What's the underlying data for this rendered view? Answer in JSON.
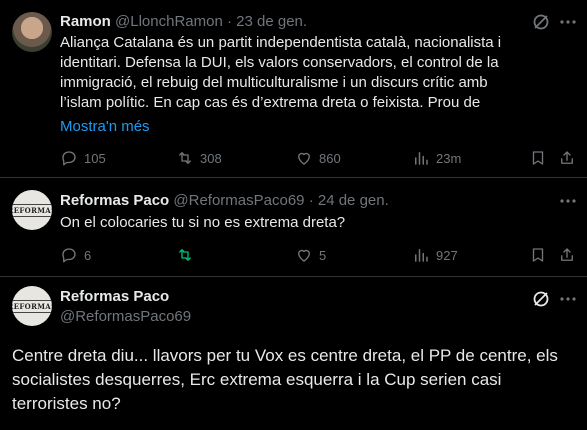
{
  "tweets": [
    {
      "name": "Ramon",
      "handle": "@LlonchRamon",
      "sep": "·",
      "date": "23 de gen.",
      "text": "Aliança Catalana és un partit independentista català, nacionalista i identitari. Defensa la DUI, els valors conservadors, el control de la immigració, el rebuig del multiculturalisme i un discurs crític amb l’islam polític. En cap cas és d’extrema dreta o feixista. Prou de",
      "show_more": "Mostra'n més",
      "replies": "105",
      "retweets": "308",
      "likes": "860",
      "views": "23m"
    },
    {
      "name": "Reformas Paco",
      "handle": "@ReformasPaco69",
      "sep": "·",
      "date": "24 de gen.",
      "text": "On el colocaries tu si no es extrema dreta?",
      "replies": "6",
      "retweets": "",
      "likes": "5",
      "views": "927"
    },
    {
      "name": "Reformas Paco",
      "handle": "@ReformasPaco69",
      "text": "Centre dreta diu... llavors per tu Vox es centre dreta, el PP de centre, els socialistes desquerres, Erc extrema esquerra i la Cup serien casi terroristes no?"
    }
  ],
  "avatar_logo_text": "REFORMAS",
  "colors": {
    "bg": "#000000",
    "text": "#e7e9ea",
    "muted": "#71767b",
    "link": "#1d9bf0",
    "retweet_active": "#00ba7c"
  },
  "icons": [
    "grok-icon",
    "more-icon",
    "reply-icon",
    "retweet-icon",
    "like-icon",
    "views-icon",
    "bookmark-icon",
    "share-icon"
  ]
}
